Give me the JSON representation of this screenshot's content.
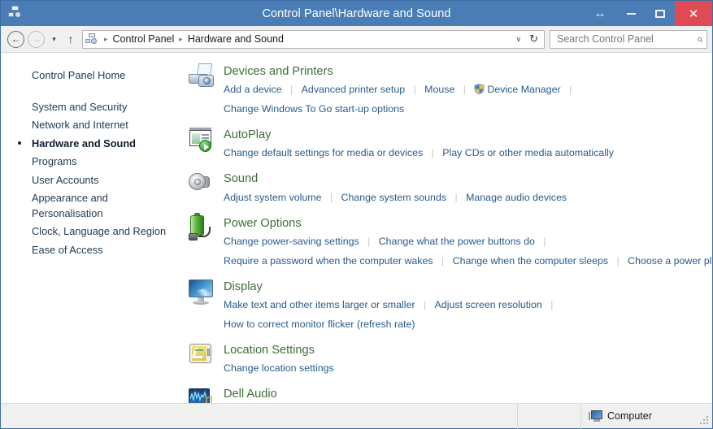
{
  "window": {
    "title": "Control Panel\\Hardware and Sound",
    "app_icon": "control-panel-icon",
    "controls": {
      "restore_arrow": "↔",
      "minimize": "minimize",
      "maximize": "maximize",
      "close": "✕"
    },
    "accent_color": "#4a7db5",
    "close_color": "#e04a53"
  },
  "toolbar": {
    "back": "←",
    "forward": "→",
    "history_chevron": "▾",
    "up": "↑",
    "breadcrumb": {
      "icon": "control-panel-icon",
      "separator": "▸",
      "items": [
        "Control Panel",
        "Hardware and Sound"
      ]
    },
    "address_chevron": "∨",
    "refresh": "↻",
    "search": {
      "placeholder": "Search Control Panel",
      "value": "",
      "icon": "search-icon"
    }
  },
  "sidebar": {
    "home": "Control Panel Home",
    "items": [
      {
        "label": "System and Security",
        "current": false
      },
      {
        "label": "Network and Internet",
        "current": false
      },
      {
        "label": "Hardware and Sound",
        "current": true
      },
      {
        "label": "Programs",
        "current": false
      },
      {
        "label": "User Accounts",
        "current": false
      },
      {
        "label": "Appearance and Personalisation",
        "current": false
      },
      {
        "label": "Clock, Language and Region",
        "current": false
      },
      {
        "label": "Ease of Access",
        "current": false
      }
    ]
  },
  "colors": {
    "heading": "#3f6e3a",
    "link": "#2a5b8c",
    "separator": "#c8c8c8"
  },
  "content": {
    "groups": [
      {
        "title": "Devices and Printers",
        "icon": "printer-camera-icon",
        "rows": [
          [
            {
              "label": "Add a device"
            },
            {
              "label": "Advanced printer setup"
            },
            {
              "label": "Mouse"
            },
            {
              "label": "Device Manager",
              "shield": true
            },
            {
              "label": ""
            }
          ],
          [
            {
              "label": "Change Windows To Go start-up options"
            }
          ]
        ]
      },
      {
        "title": "AutoPlay",
        "icon": "autoplay-icon",
        "rows": [
          [
            {
              "label": "Change default settings for media or devices"
            },
            {
              "label": "Play CDs or other media automatically"
            }
          ]
        ]
      },
      {
        "title": "Sound",
        "icon": "speaker-icon",
        "rows": [
          [
            {
              "label": "Adjust system volume"
            },
            {
              "label": "Change system sounds"
            },
            {
              "label": "Manage audio devices"
            }
          ]
        ]
      },
      {
        "title": "Power Options",
        "icon": "battery-plug-icon",
        "rows": [
          [
            {
              "label": "Change power-saving settings"
            },
            {
              "label": "Change what the power buttons do"
            },
            {
              "label": ""
            }
          ],
          [
            {
              "label": "Require a password when the computer wakes"
            },
            {
              "label": "Change when the computer sleeps"
            },
            {
              "label": "Choose a power plan"
            }
          ]
        ]
      },
      {
        "title": "Display",
        "icon": "monitor-icon",
        "rows": [
          [
            {
              "label": "Make text and other items larger or smaller"
            },
            {
              "label": "Adjust screen resolution"
            },
            {
              "label": ""
            }
          ],
          [
            {
              "label": "How to correct monitor flicker (refresh rate)"
            }
          ]
        ]
      },
      {
        "title": "Location Settings",
        "icon": "gps-device-icon",
        "rows": [
          [
            {
              "label": "Change location settings"
            }
          ]
        ]
      },
      {
        "title": "Dell Audio",
        "icon": "dell-audio-icon",
        "rows": []
      }
    ]
  },
  "statusbar": {
    "label": "Computer",
    "icon": "computer-icon"
  }
}
